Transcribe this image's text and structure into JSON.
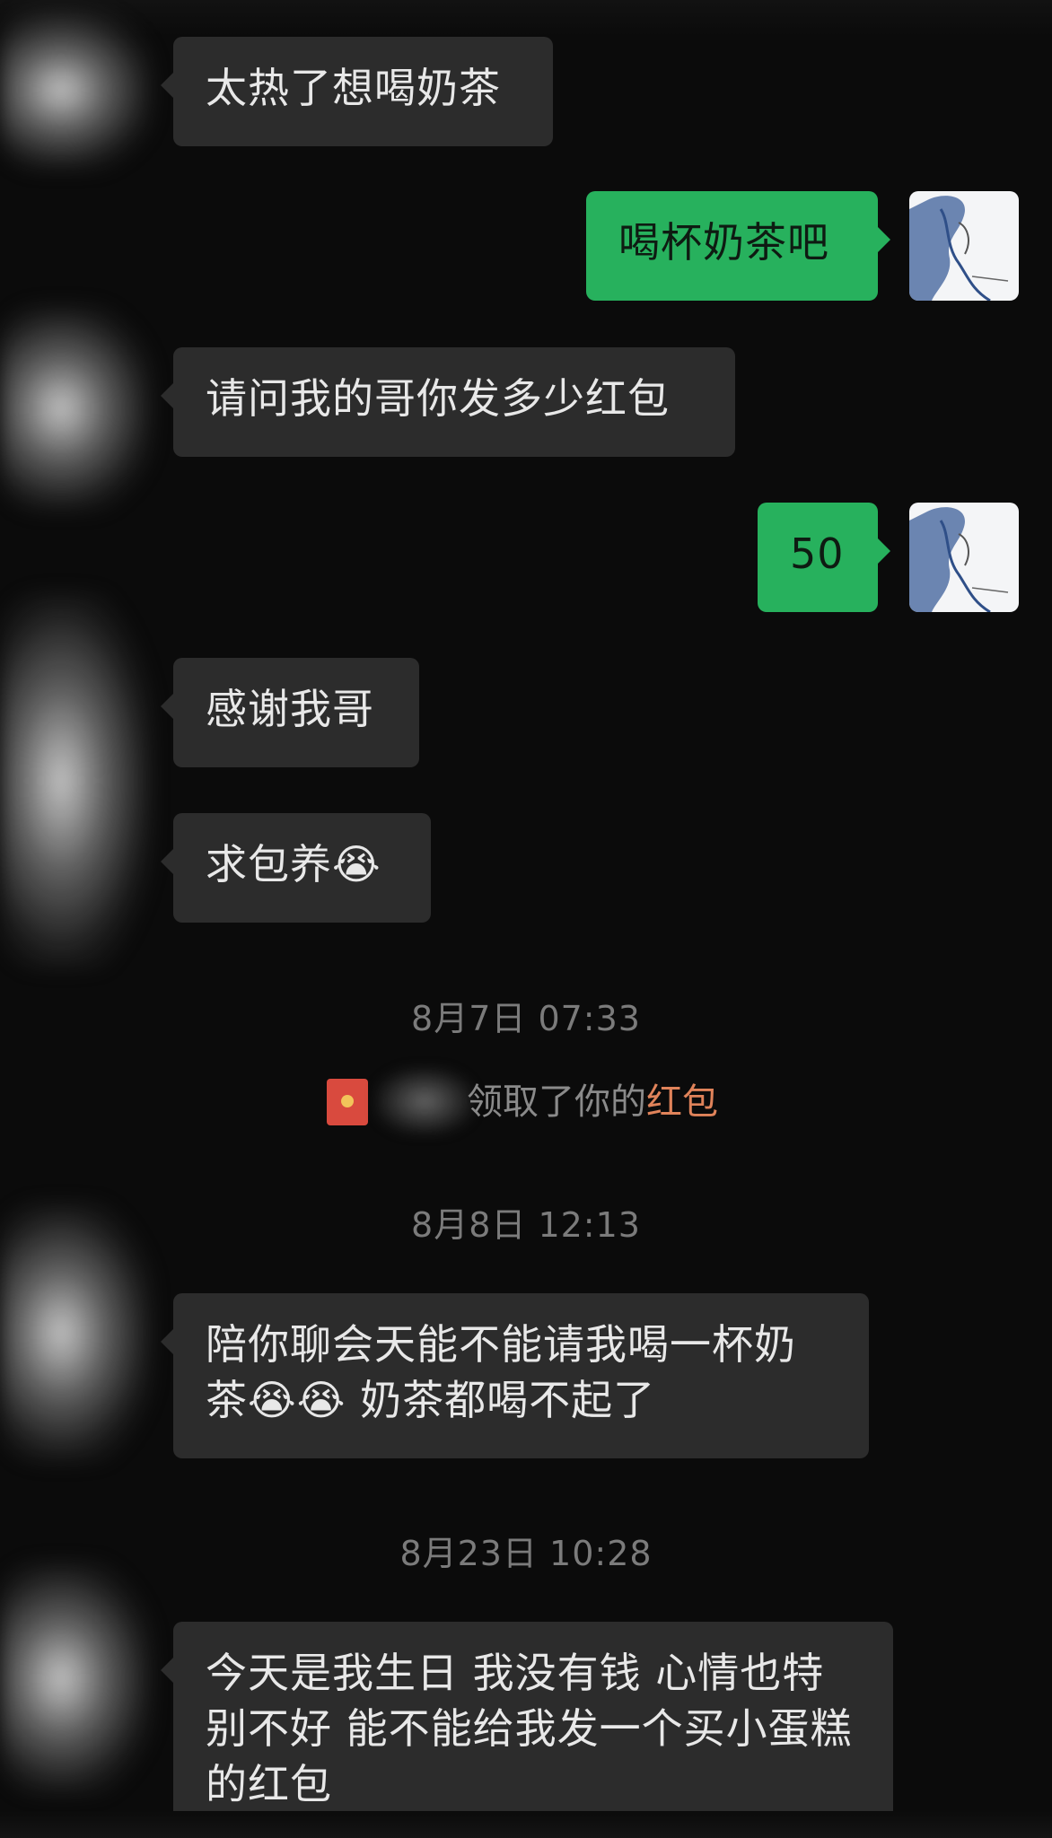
{
  "messages": [
    {
      "side": "in",
      "text": "太热了想喝奶茶"
    },
    {
      "side": "out",
      "text": "喝杯奶茶吧"
    },
    {
      "side": "in",
      "text": "请问我的哥你发多少红包"
    },
    {
      "side": "out",
      "text": "50"
    },
    {
      "side": "in",
      "text": "感谢我哥"
    },
    {
      "side": "in",
      "text": "求包养😭"
    },
    {
      "side": "in",
      "text": "陪你聊会天能不能请我喝一杯奶茶😭😭 奶茶都喝不起了"
    },
    {
      "side": "in",
      "text": "今天是我生日 我没有钱 心情也特别不好 能不能给我发一个买小蛋糕的红包"
    }
  ],
  "timestamps": {
    "t1": "8月7日 07:33",
    "t2": "8月8日 12:13",
    "t3": "8月23日 10:28"
  },
  "system": {
    "text": "领取了你的",
    "link": "红包"
  },
  "colors": {
    "background": "#0b0b0b",
    "incoming_bubble": "#2c2c2c",
    "outgoing_bubble": "#27b15d",
    "red_packet": "#d94a3e",
    "link": "#e0835a"
  }
}
